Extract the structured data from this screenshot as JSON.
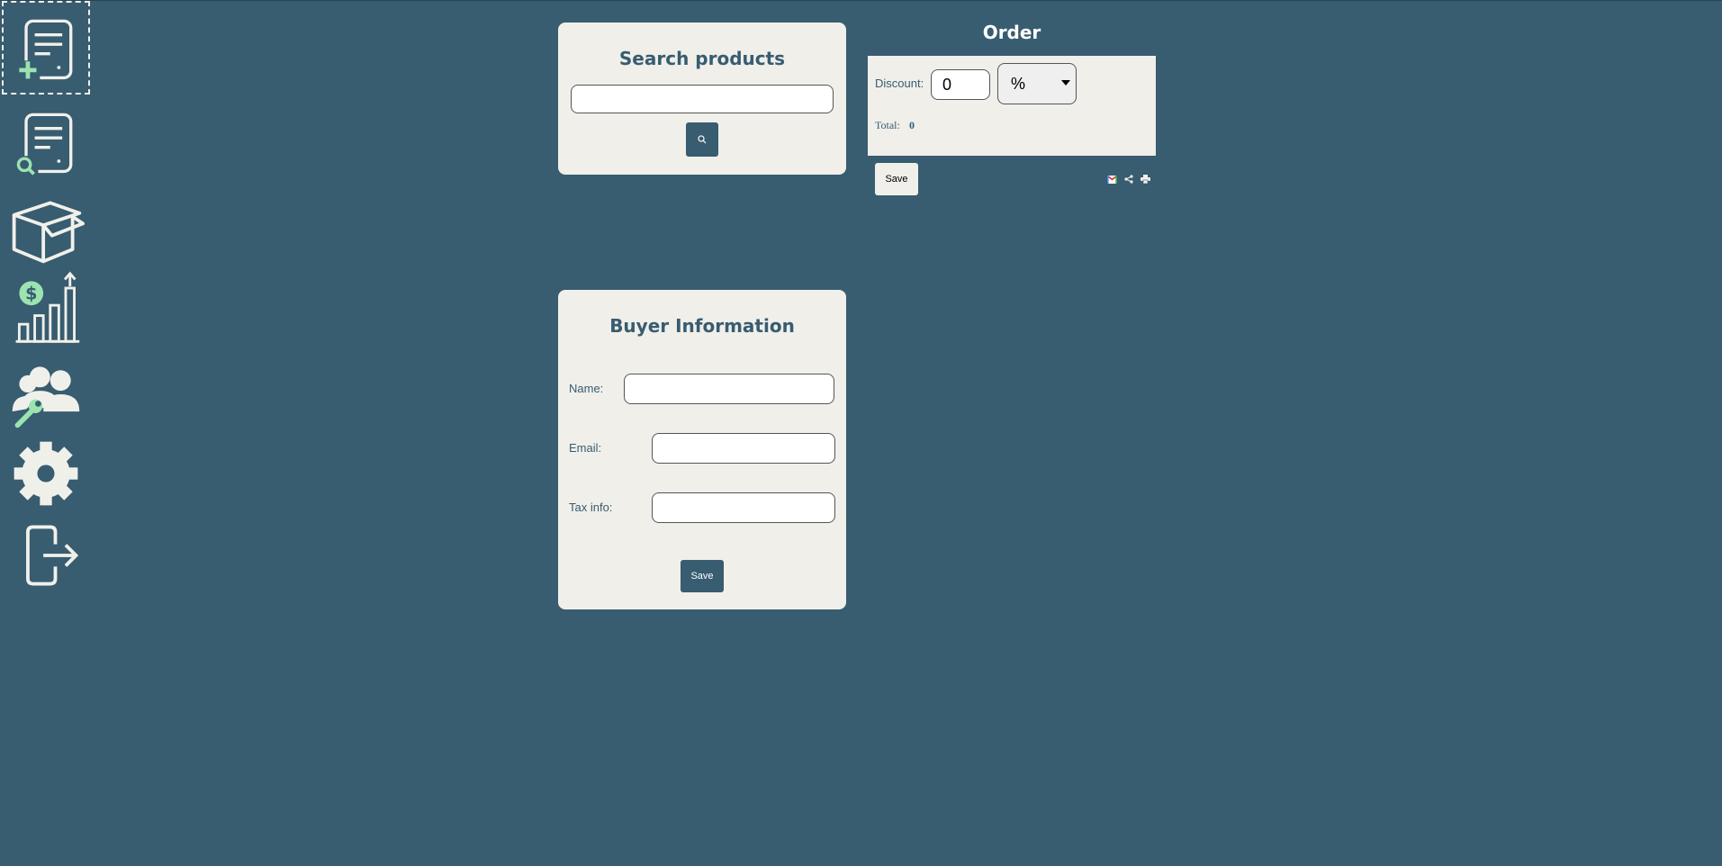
{
  "sidebar": {
    "items": [
      {
        "name": "new-document-icon",
        "active": true
      },
      {
        "name": "search-documents-icon",
        "active": false
      },
      {
        "name": "products-box-icon",
        "active": false
      },
      {
        "name": "sales-chart-icon",
        "active": false
      },
      {
        "name": "users-admin-icon",
        "active": false
      },
      {
        "name": "gear-icon",
        "active": false
      },
      {
        "name": "logout-icon",
        "active": false
      }
    ]
  },
  "search": {
    "title": "Search products",
    "input_value": "",
    "button_icon": "search-icon"
  },
  "order": {
    "title": "Order",
    "discount_label": "Discount:",
    "discount_value": "0",
    "discount_type": "%",
    "total_label": "Total:",
    "total_value": "0",
    "save_label": "Save",
    "action_icons": [
      "gmail-icon",
      "share-icon",
      "print-icon"
    ]
  },
  "buyer": {
    "title": "Buyer Information",
    "name_label": "Name:",
    "name_value": "",
    "email_label": "Email:",
    "email_value": "",
    "tax_label": "Tax info:",
    "tax_value": "",
    "save_label": "Save"
  },
  "colors": {
    "background": "#385c70",
    "panel": "#f0efea",
    "accent_green": "#9be3b0",
    "text_primary": "#385c70"
  }
}
